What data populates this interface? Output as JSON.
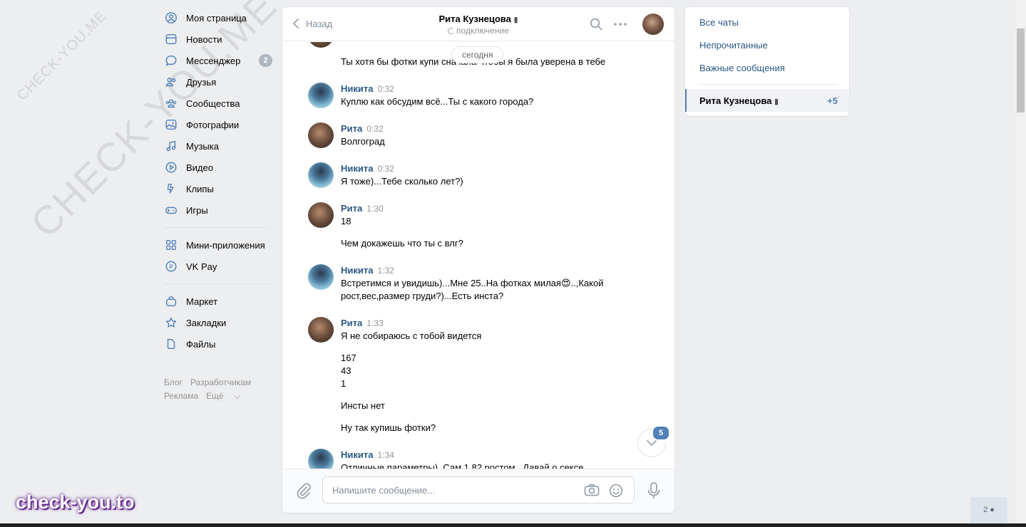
{
  "nav": {
    "items": [
      {
        "label": "Моя страница",
        "icon": "user-circle-icon"
      },
      {
        "label": "Новости",
        "icon": "news-icon"
      },
      {
        "label": "Мессенджер",
        "icon": "messenger-icon",
        "counter": "2"
      },
      {
        "label": "Друзья",
        "icon": "friends-icon"
      },
      {
        "label": "Сообщества",
        "icon": "communities-icon"
      },
      {
        "label": "Фотографии",
        "icon": "photos-icon"
      },
      {
        "label": "Музыка",
        "icon": "music-icon"
      },
      {
        "label": "Видео",
        "icon": "video-icon"
      },
      {
        "label": "Клипы",
        "icon": "clips-icon"
      },
      {
        "label": "Игры",
        "icon": "games-icon"
      }
    ],
    "group2": [
      {
        "label": "Мини-приложения",
        "icon": "mini-apps-icon"
      },
      {
        "label": "VK Pay",
        "icon": "vkpay-icon"
      }
    ],
    "group3": [
      {
        "label": "Маркет",
        "icon": "market-icon"
      },
      {
        "label": "Закладки",
        "icon": "bookmarks-icon"
      },
      {
        "label": "Файлы",
        "icon": "files-icon"
      }
    ],
    "footer": {
      "blog": "Блог",
      "dev": "Разработчикам",
      "ads": "Реклама",
      "more": "Ещё"
    }
  },
  "chat": {
    "back_label": "Назад",
    "title": "Рита Кузнецова",
    "status": "подключение",
    "date_pill": "сегодня",
    "partial_top_line": "Ты хотя бы фотки купи сначала чтобы я была уверена в тебе",
    "messages": [
      {
        "author": "Никита",
        "time": "0:32",
        "text": "Куплю как обсудим всё...Ты с какого города?"
      },
      {
        "author": "Рита",
        "time": "0:32",
        "text": "Волгоград"
      },
      {
        "author": "Никита",
        "time": "0:32",
        "text": "Я тоже)...Тебе сколько лет?)"
      },
      {
        "author": "Рита",
        "time": "1:30",
        "text": "18",
        "extra": "Чем докажешь что ты с влг?"
      },
      {
        "author": "Никита",
        "time": "1:32",
        "text": "Встретимся и увидишь)...Мне 25..На фотках милая😍..,Какой рост,вес,размер груди?)...Есть инста?"
      },
      {
        "author": "Рита",
        "time": "1:33",
        "text": "Я не собираюсь с тобой видется",
        "extra": "167\n43\n1",
        "extra2": "Инсты нет",
        "extra3": "Ну так купишь фотки?"
      },
      {
        "author": "Никита",
        "time": "1:34",
        "text": "Отличные параметры)..Сам 1,82 ростом...Давай о сексе"
      }
    ],
    "scroll_badge": "5",
    "composer_placeholder": "Напишите сообщение..."
  },
  "right": {
    "all_chats": "Все чаты",
    "unread": "Непрочитанные",
    "important": "Важные сообщения",
    "active_chat": "Рита Кузнецова",
    "active_count": "+5"
  },
  "watermark": {
    "small": "CHECK-YOU.ME",
    "large": "CHECK-YOU.ME",
    "brand": "check-you.to"
  },
  "people_counter": "2"
}
